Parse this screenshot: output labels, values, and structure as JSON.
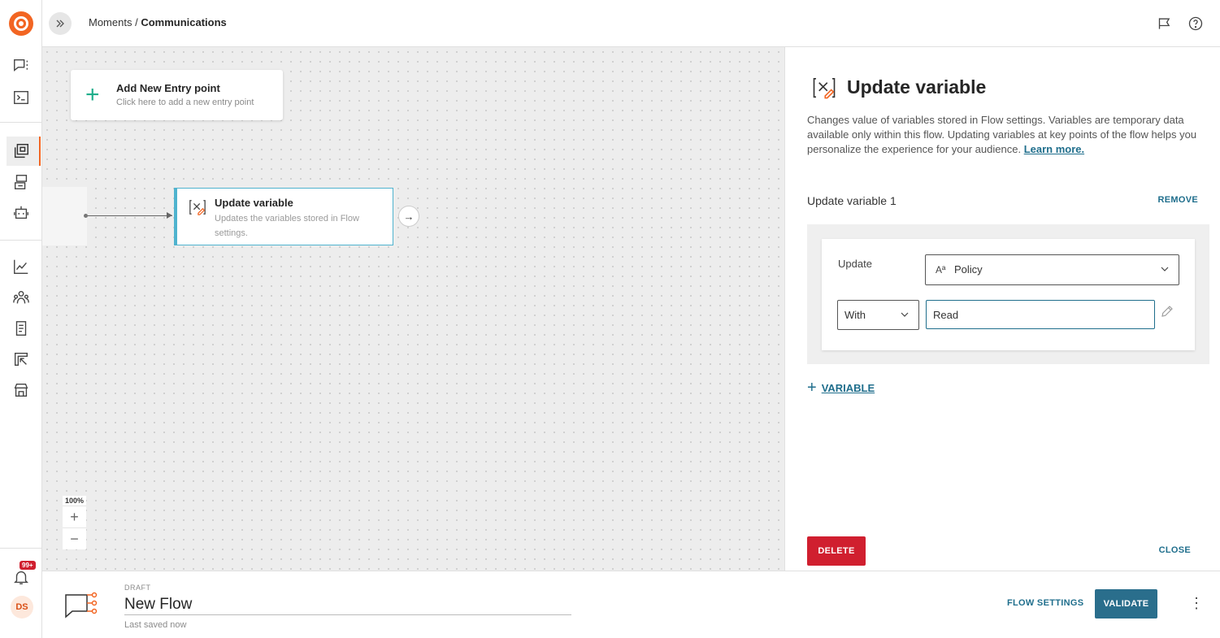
{
  "header": {
    "breadcrumb_parent": "Moments",
    "breadcrumb_sep": " / ",
    "breadcrumb_current": "Communications"
  },
  "rail": {
    "notification_badge": "99+",
    "avatar_initials": "DS"
  },
  "canvas": {
    "entry_card": {
      "title": "Add New Entry point",
      "subtitle": "Click here to add a new entry point"
    },
    "node": {
      "title": "Update variable",
      "subtitle": "Updates the variables stored in Flow settings."
    },
    "zoom_level": "100%",
    "zoom_in": "+",
    "zoom_out": "−"
  },
  "panel": {
    "title": "Update variable",
    "description": "Changes value of variables stored in Flow settings. Variables are temporary data available only within this flow. Updating variables at key points of the flow helps you personalize the experience for your audience.",
    "learn_more": "Learn more.",
    "section_title": "Update variable 1",
    "remove_label": "REMOVE",
    "update_label": "Update",
    "update_type_icon": "Aª",
    "update_value": "Policy",
    "with_value": "With",
    "with_input_value": "Read",
    "add_variable_label": "VARIABLE",
    "delete_label": "DELETE",
    "close_label": "CLOSE"
  },
  "footer": {
    "status": "DRAFT",
    "flow_name": "New Flow",
    "last_saved": "Last saved now",
    "flow_settings_label": "FLOW SETTINGS",
    "validate_label": "VALIDATE",
    "more_label": "⋮"
  },
  "colors": {
    "brand": "#f26522",
    "link": "#1f6e8c",
    "validate": "#2a6e8c",
    "danger": "#d01f2f",
    "node_border": "#4fb3ce"
  }
}
